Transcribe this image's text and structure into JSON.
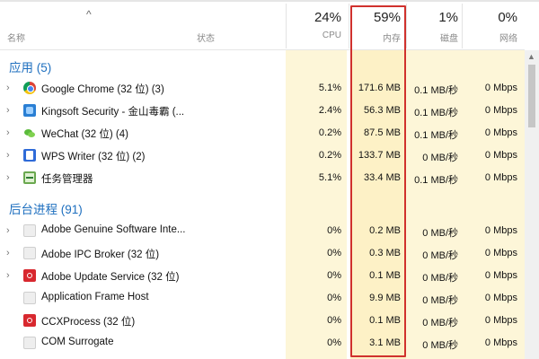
{
  "header": {
    "sort_caret": "^",
    "name_label": "名称",
    "status_label": "状态",
    "cpu_pct": "24%",
    "cpu_label": "CPU",
    "mem_pct": "59%",
    "mem_label": "内存",
    "disk_pct": "1%",
    "disk_label": "磁盘",
    "net_pct": "0%",
    "net_label": "网络"
  },
  "groups": {
    "apps": "应用 (5)",
    "background": "后台进程 (91)"
  },
  "apps": [
    {
      "name": "Google Chrome (32 位) (3)",
      "icon": "chrome-icon",
      "cpu": "5.1%",
      "mem": "171.6 MB",
      "disk": "0.1 MB/秒",
      "net": "0 Mbps"
    },
    {
      "name": "Kingsoft Security - 金山毒霸 (...",
      "icon": "kingsoft-icon",
      "cpu": "2.4%",
      "mem": "56.3 MB",
      "disk": "0.1 MB/秒",
      "net": "0 Mbps"
    },
    {
      "name": "WeChat (32 位) (4)",
      "icon": "wechat-icon",
      "cpu": "0.2%",
      "mem": "87.5 MB",
      "disk": "0.1 MB/秒",
      "net": "0 Mbps"
    },
    {
      "name": "WPS Writer (32 位) (2)",
      "icon": "wps-writer-icon",
      "cpu": "0.2%",
      "mem": "133.7 MB",
      "disk": "0 MB/秒",
      "net": "0 Mbps"
    },
    {
      "name": "任务管理器",
      "icon": "task-manager-icon",
      "cpu": "5.1%",
      "mem": "33.4 MB",
      "disk": "0.1 MB/秒",
      "net": "0 Mbps"
    }
  ],
  "background": [
    {
      "name": "Adobe Genuine Software Inte...",
      "icon": "adobe-genuine-icon",
      "cpu": "0%",
      "mem": "0.2 MB",
      "disk": "0 MB/秒",
      "net": "0 Mbps"
    },
    {
      "name": "Adobe IPC Broker (32 位)",
      "icon": "adobe-ipc-icon",
      "cpu": "0%",
      "mem": "0.3 MB",
      "disk": "0 MB/秒",
      "net": "0 Mbps"
    },
    {
      "name": "Adobe Update Service (32 位)",
      "icon": "adobe-update-icon",
      "cpu": "0%",
      "mem": "0.1 MB",
      "disk": "0 MB/秒",
      "net": "0 Mbps"
    },
    {
      "name": "Application Frame Host",
      "icon": "app-frame-host-icon",
      "cpu": "0%",
      "mem": "9.9 MB",
      "disk": "0 MB/秒",
      "net": "0 Mbps"
    },
    {
      "name": "CCXProcess (32 位)",
      "icon": "ccxprocess-icon",
      "cpu": "0%",
      "mem": "0.1 MB",
      "disk": "0 MB/秒",
      "net": "0 Mbps"
    },
    {
      "name": "COM Surrogate",
      "icon": "com-surrogate-icon",
      "cpu": "0%",
      "mem": "3.1 MB",
      "disk": "0 MB/秒",
      "net": "0 Mbps"
    }
  ],
  "colors": {
    "stripe_strong": "#fdf1c6",
    "stripe_light": "#fdf6d8",
    "group_text": "#1e6fbf",
    "highlight_frame": "#d0312d"
  }
}
